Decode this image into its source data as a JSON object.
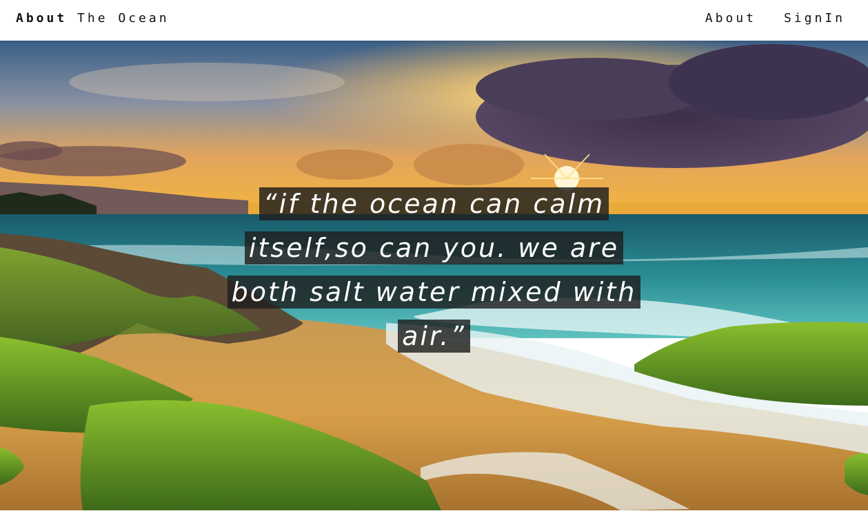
{
  "header": {
    "brand_bold": "About",
    "brand_rest": " The Ocean",
    "nav": [
      {
        "label": "About"
      },
      {
        "label": "SignIn"
      }
    ]
  },
  "hero": {
    "quote": "“if the ocean can calm itself,so can you. we are both salt water mixed with air.”"
  },
  "colors": {
    "quote_background": "#1e1e1e",
    "quote_text": "#ffffff",
    "header_background": "#ffffff"
  }
}
